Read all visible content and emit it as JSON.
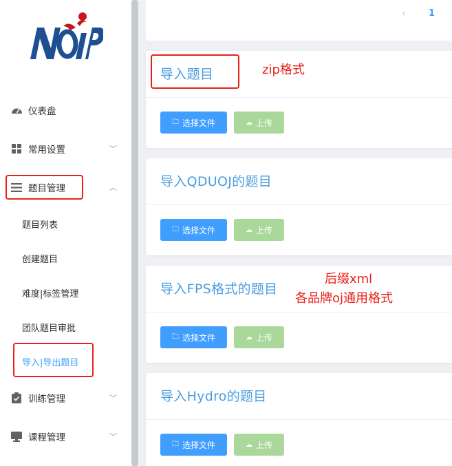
{
  "logo": {
    "text": "NOIP"
  },
  "sidebar": {
    "items": [
      {
        "label": "仪表盘"
      },
      {
        "label": "常用设置"
      },
      {
        "label": "题目管理"
      },
      {
        "label": "训练管理"
      },
      {
        "label": "课程管理"
      }
    ],
    "sub_items": [
      {
        "label": "题目列表"
      },
      {
        "label": "创建题目"
      },
      {
        "label": "难度|标签管理"
      },
      {
        "label": "团队题目审批"
      },
      {
        "label": "导入|导出题目"
      }
    ]
  },
  "pagination": {
    "prev": "‹",
    "current": "1"
  },
  "cards": [
    {
      "title": "导入题目",
      "select_label": "选择文件",
      "upload_label": "上传"
    },
    {
      "title": "导入QDUOJ的题目",
      "select_label": "选择文件",
      "upload_label": "上传"
    },
    {
      "title": "导入FPS格式的题目",
      "select_label": "选择文件",
      "upload_label": "上传"
    },
    {
      "title": "导入Hydro的题目",
      "select_label": "选择文件",
      "upload_label": "上传"
    }
  ],
  "annotations": {
    "zip_note": "zip格式",
    "xml_note_line1": "后缀xml",
    "xml_note_line2": "各品牌oj通用格式"
  },
  "colors": {
    "accent": "#409eff",
    "annotation": "#e8201a",
    "upload_disabled": "#a9d89a"
  },
  "icons": [
    "dashboard-icon",
    "grid-icon",
    "menu-lines-icon",
    "clipboard-icon",
    "monitor-icon",
    "folder-icon",
    "cloud-upload-icon"
  ]
}
